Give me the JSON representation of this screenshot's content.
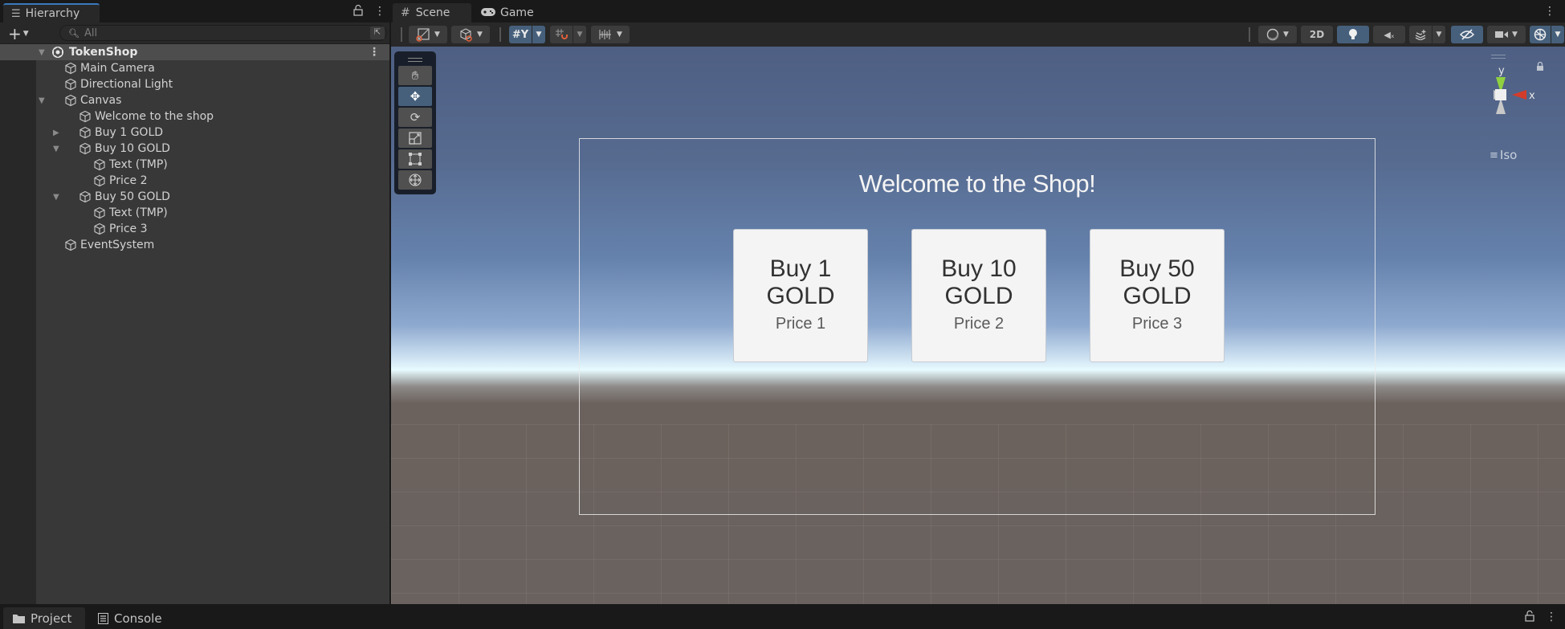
{
  "hierarchy": {
    "tab_label": "Hierarchy",
    "tab_icon": "hierarchy-list-icon",
    "search_placeholder": "All",
    "scene_name": "TokenShop",
    "items": [
      {
        "label": "Main Camera",
        "depth": 1,
        "expander": "none"
      },
      {
        "label": "Directional Light",
        "depth": 1,
        "expander": "none"
      },
      {
        "label": "Canvas",
        "depth": 1,
        "expander": "expanded"
      },
      {
        "label": "Welcome to the shop",
        "depth": 2,
        "expander": "none"
      },
      {
        "label": "Buy 1 GOLD",
        "depth": 2,
        "expander": "collapsed"
      },
      {
        "label": "Buy 10 GOLD",
        "depth": 2,
        "expander": "expanded"
      },
      {
        "label": "Text (TMP)",
        "depth": 3,
        "expander": "none"
      },
      {
        "label": "Price 2",
        "depth": 3,
        "expander": "none"
      },
      {
        "label": "Buy 50 GOLD",
        "depth": 2,
        "expander": "expanded"
      },
      {
        "label": "Text (TMP)",
        "depth": 3,
        "expander": "none"
      },
      {
        "label": "Price 3",
        "depth": 3,
        "expander": "none"
      },
      {
        "label": "EventSystem",
        "depth": 1,
        "expander": "none"
      }
    ]
  },
  "scene_view": {
    "tabs": [
      {
        "label": "Scene",
        "icon": "grid-hash-icon",
        "active": true
      },
      {
        "label": "Game",
        "icon": "gamepad-icon",
        "active": false
      }
    ],
    "toolbar": {
      "mode_2d_label": "2D",
      "iso_label": "Iso",
      "gizmo_axes": {
        "y": "y",
        "x": "x"
      }
    },
    "tools": [
      "hand-tool",
      "move-tool",
      "rotate-tool",
      "scale-tool",
      "rect-tool",
      "transform-tool"
    ],
    "active_tool": "move-tool"
  },
  "game_ui": {
    "title": "Welcome to the Shop!",
    "buttons": [
      {
        "line1": "Buy 1",
        "line2": "GOLD",
        "price": "Price 1"
      },
      {
        "line1": "Buy 10",
        "line2": "GOLD",
        "price": "Price 2"
      },
      {
        "line1": "Buy 50",
        "line2": "GOLD",
        "price": "Price 3"
      }
    ]
  },
  "bottom_panel": {
    "tabs": [
      {
        "label": "Project",
        "active": true
      },
      {
        "label": "Console",
        "active": false
      }
    ]
  },
  "colors": {
    "accent_blue": "#46607c",
    "gizmo_y": "#8fd13f",
    "gizmo_x": "#d33c2b",
    "tool_orange": "#e0603a"
  }
}
